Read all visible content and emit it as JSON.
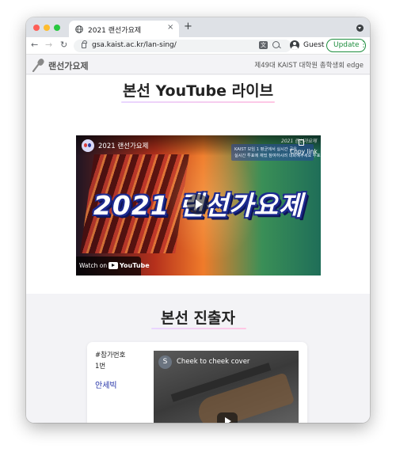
{
  "browser": {
    "tab_title": "2021 랜선가요제",
    "tab_close": "×",
    "new_tab": "+",
    "url": "gsa.kaist.ac.kr/lan-sing/",
    "profile_label": "Guest",
    "update_label": "Update",
    "update_menu": "⋮",
    "back": "←",
    "forward": "→",
    "reload": "↻",
    "translate_glyph": "文"
  },
  "site": {
    "name": "랜선가요제",
    "subtitle": "제49대 KAIST 대학원 총학생회 edge"
  },
  "live_section": {
    "heading": "본선 YouTube 라이브",
    "video": {
      "channel_title": "2021 랜선가요제",
      "overlay_title": "2021 랜선가요제",
      "corner_tag": "2021 랜선가요제",
      "notice_line1": "KAIST 보임 1 평균에서 실시간 공유",
      "notice_line2": "실시간 투표에 재밌 참여하시려 대화해주세요 투표",
      "copy_link": "Copy link",
      "watch_on": "Watch on",
      "youtube": "YouTube"
    }
  },
  "finalists_section": {
    "heading": "본선 진출자",
    "cards": [
      {
        "label": "#참가번호",
        "number": "1번",
        "name": "안세빅",
        "clip_title": "Cheek to cheek cover",
        "clip_avatar": "S"
      }
    ]
  },
  "colors": {
    "accent_green": "#1e8e3e",
    "name_blue": "#2130a6",
    "page_bg": "#f3f3f6"
  }
}
